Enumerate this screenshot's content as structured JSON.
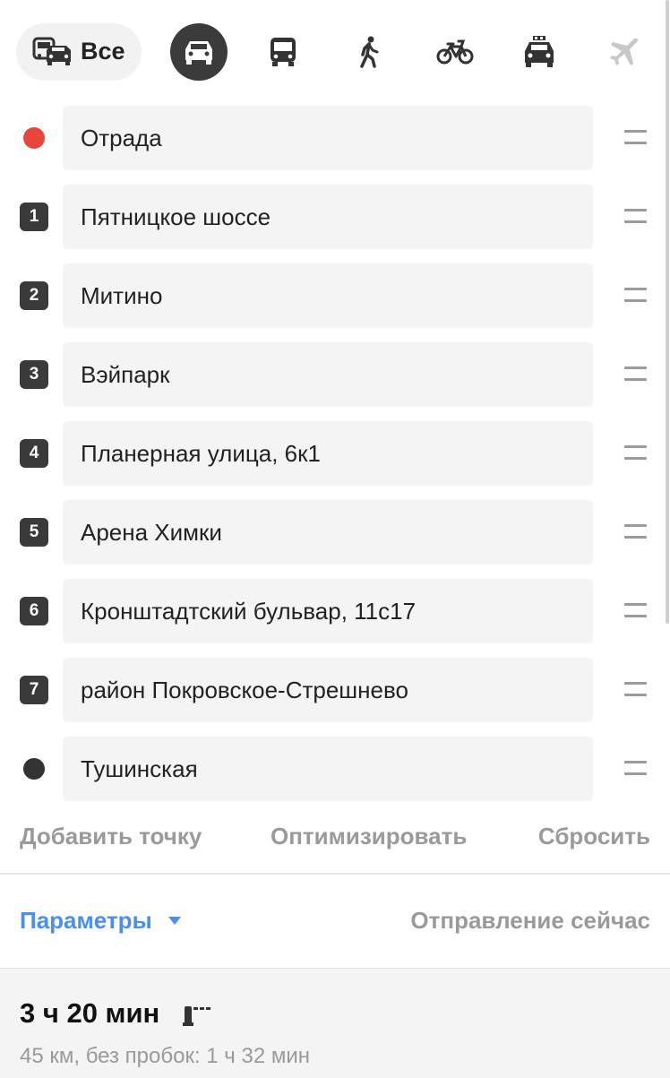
{
  "modes": {
    "all_label": "Все",
    "items": [
      {
        "id": "all",
        "icon": "car-bus-icon"
      },
      {
        "id": "car",
        "icon": "car-icon",
        "active": true
      },
      {
        "id": "transit",
        "icon": "bus-icon"
      },
      {
        "id": "walk",
        "icon": "pedestrian-icon"
      },
      {
        "id": "bike",
        "icon": "bicycle-icon"
      },
      {
        "id": "taxi",
        "icon": "taxi-icon"
      },
      {
        "id": "plane",
        "icon": "airplane-icon"
      }
    ]
  },
  "stops": [
    {
      "marker": "",
      "marker_type": "start",
      "value": "Отрада"
    },
    {
      "marker": "1",
      "marker_type": "number",
      "value": "Пятницкое шоссе"
    },
    {
      "marker": "2",
      "marker_type": "number",
      "value": "Митино"
    },
    {
      "marker": "3",
      "marker_type": "number",
      "value": "Вэйпарк"
    },
    {
      "marker": "4",
      "marker_type": "number",
      "value": "Планерная улица, 6к1"
    },
    {
      "marker": "5",
      "marker_type": "number",
      "value": "Арена Химки"
    },
    {
      "marker": "6",
      "marker_type": "number",
      "value": "Кронштадтский бульвар, 11с17"
    },
    {
      "marker": "7",
      "marker_type": "number",
      "value": "район Покровское-Стрешнево"
    },
    {
      "marker": "",
      "marker_type": "end",
      "value": "Тушинская"
    }
  ],
  "actions": {
    "add_point": "Добавить точку",
    "optimize": "Оптимизировать",
    "reset": "Сбросить"
  },
  "params": {
    "label": "Параметры",
    "departure": "Отправление сейчас"
  },
  "result": {
    "duration": "3 ч 20 мин",
    "details": "45 км, без пробок: 1 ч 32 мин",
    "icon": "toll-barrier-icon"
  },
  "colors": {
    "start_marker": "#e8463c",
    "end_marker": "#333333",
    "link": "#4b8ef0",
    "muted": "#9a9a9a",
    "active_mode_bg": "#3b3b3b"
  }
}
